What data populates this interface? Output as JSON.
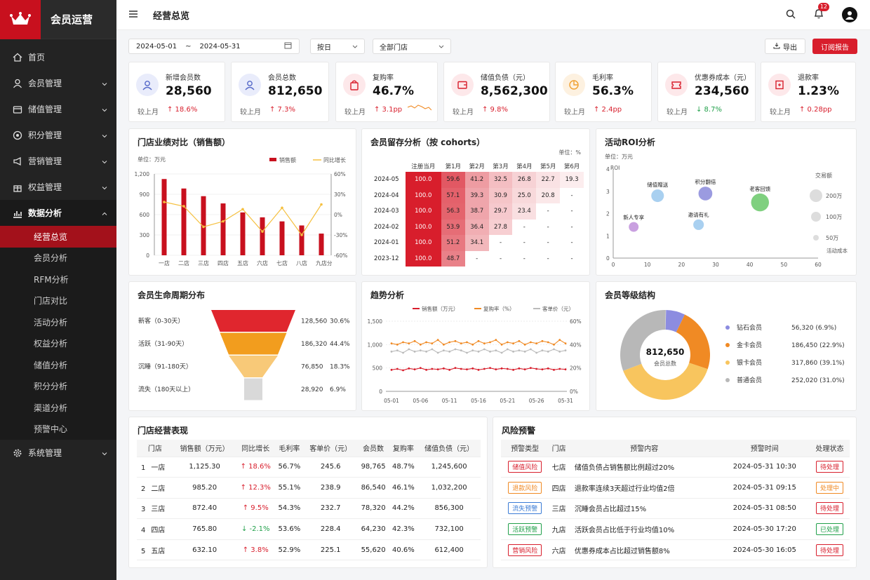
{
  "brand": {
    "name": "会员运营"
  },
  "nav": [
    {
      "label": "首页",
      "icon": "home-icon",
      "has_chevron": false
    },
    {
      "label": "会员管理",
      "icon": "user-icon",
      "has_chevron": true
    },
    {
      "label": "储值管理",
      "icon": "wallet-icon",
      "has_chevron": true
    },
    {
      "label": "积分管理",
      "icon": "points-icon",
      "has_chevron": true
    },
    {
      "label": "营销管理",
      "icon": "megaphone-icon",
      "has_chevron": true
    },
    {
      "label": "权益管理",
      "icon": "gift-icon",
      "has_chevron": true
    },
    {
      "label": "数据分析",
      "icon": "chart-icon",
      "has_chevron": true,
      "open": true
    },
    {
      "label": "系统管理",
      "icon": "gear-icon",
      "has_chevron": true
    }
  ],
  "subnav": [
    "经营总览",
    "会员分析",
    "RFM分析",
    "门店对比",
    "活动分析",
    "权益分析",
    "储值分析",
    "积分分析",
    "渠道分析",
    "预警中心"
  ],
  "topbar": {
    "title": "经营总览",
    "notif_count": "12"
  },
  "filters": {
    "date_start": "2024-05-01",
    "date_sep": "~",
    "date_end": "2024-05-31",
    "period": "按日",
    "store": "全部门店",
    "export": "导出",
    "subscribe": "订阅报告"
  },
  "kpis": [
    {
      "label": "新增会员数",
      "value": "28,560",
      "cmp": "较上月",
      "change": "↑ 18.6%",
      "dir": "up",
      "icon": "user-icon",
      "bg": "#e9ecfb",
      "fg": "#5568c8"
    },
    {
      "label": "会员总数",
      "value": "812,650",
      "cmp": "较上月",
      "change": "↑ 7.3%",
      "dir": "up",
      "icon": "users-icon",
      "bg": "#e9ecfb",
      "fg": "#5568c8"
    },
    {
      "label": "复购率",
      "value": "46.7%",
      "cmp": "较上月",
      "change": "↑ 3.1pp",
      "dir": "up",
      "icon": "bag-icon",
      "bg": "#fde8ea",
      "fg": "#d81e2c"
    },
    {
      "label": "储值负债（元）",
      "value": "8,562,300",
      "cmp": "较上月",
      "change": "↑ 9.8%",
      "dir": "up",
      "icon": "wallet-icon",
      "bg": "#fde8ea",
      "fg": "#d81e2c"
    },
    {
      "label": "毛利率",
      "value": "56.3%",
      "cmp": "较上月",
      "change": "↑ 2.4pp",
      "dir": "up",
      "icon": "pie-icon",
      "bg": "#fdf1e0",
      "fg": "#f0a030"
    },
    {
      "label": "优惠券成本（元）",
      "value": "234,560",
      "cmp": "较上月",
      "change": "↓ 8.7%",
      "dir": "down",
      "icon": "coupon-icon",
      "bg": "#fde8ea",
      "fg": "#d81e2c"
    },
    {
      "label": "退款率",
      "value": "1.23%",
      "cmp": "较上月",
      "change": "↑ 0.28pp",
      "dir": "up",
      "icon": "refund-icon",
      "bg": "#fde8ea",
      "fg": "#d81e2c"
    }
  ],
  "chart_data": [
    {
      "type": "bar",
      "title": "门店业绩对比（销售额）",
      "unit": "单位：万元",
      "categories": [
        "一店",
        "二店",
        "三店",
        "四店",
        "五店",
        "六店",
        "七店",
        "八店",
        "九店"
      ],
      "series": [
        {
          "name": "销售额",
          "values": [
            1125,
            985,
            872,
            765,
            632,
            560,
            500,
            440,
            320
          ]
        },
        {
          "name": "同比增长",
          "values": [
            18.6,
            12.3,
            -18,
            -10,
            8,
            -25,
            10,
            -30,
            15
          ]
        }
      ],
      "ylim": [
        0,
        1200
      ],
      "y2lim": [
        -60,
        60
      ],
      "yticks": [
        "1,200",
        "900",
        "600",
        "300",
        "0"
      ],
      "y2ticks": [
        "60%",
        "30%",
        "0%",
        "-30%",
        "-60%"
      ],
      "x_overflow": "分"
    },
    {
      "type": "table",
      "title": "会员留存分析（按 cohorts）",
      "unit": "单位：%",
      "columns": [
        "注册当月",
        "第1月",
        "第2月",
        "第3月",
        "第4月",
        "第5月",
        "第6月"
      ],
      "rows": [
        {
          "cohort": "2024-05",
          "values": [
            "100.0",
            "59.6",
            "41.2",
            "32.5",
            "26.8",
            "22.7",
            "19.3"
          ]
        },
        {
          "cohort": "2024-04",
          "values": [
            "100.0",
            "57.1",
            "39.3",
            "30.9",
            "25.0",
            "20.8",
            "-"
          ]
        },
        {
          "cohort": "2024-03",
          "values": [
            "100.0",
            "56.3",
            "38.7",
            "29.7",
            "23.4",
            "-",
            "-"
          ]
        },
        {
          "cohort": "2024-02",
          "values": [
            "100.0",
            "53.9",
            "36.4",
            "27.8",
            "-",
            "-",
            "-"
          ]
        },
        {
          "cohort": "2024-01",
          "values": [
            "100.0",
            "51.2",
            "34.1",
            "-",
            "-",
            "-",
            "-"
          ]
        },
        {
          "cohort": "2023-12",
          "values": [
            "100.0",
            "48.7",
            "-",
            "-",
            "-",
            "-",
            "-"
          ]
        }
      ]
    },
    {
      "type": "scatter",
      "title": "活动ROI分析",
      "unit": "单位：万元",
      "xlabel": "活动成本",
      "ylabel": "ROI",
      "xlim": [
        0,
        60
      ],
      "ylim": [
        0,
        4
      ],
      "size_legend_title": "交易额",
      "size_legend": [
        "200万",
        "100万",
        "50万"
      ],
      "points": [
        {
          "name": "储值赠送",
          "x": 13,
          "y": 2.8,
          "size": 100,
          "color": "#a9d0f0"
        },
        {
          "name": "积分翻倍",
          "x": 27,
          "y": 2.9,
          "size": 120,
          "color": "#9b9be0"
        },
        {
          "name": "老客回馈",
          "x": 43,
          "y": 2.5,
          "size": 200,
          "color": "#7fd07f"
        },
        {
          "name": "新人专享",
          "x": 6,
          "y": 1.4,
          "size": 60,
          "color": "#c9a0e0"
        },
        {
          "name": "邀请有礼",
          "x": 25,
          "y": 1.5,
          "size": 70,
          "color": "#a9d0f0"
        }
      ]
    },
    {
      "type": "funnel",
      "title": "会员生命周期分布",
      "stages": [
        {
          "label": "新客（0-30天）",
          "count": "128,560",
          "pct": "30.6%",
          "color": "#e0262e"
        },
        {
          "label": "活跃（31-90天）",
          "count": "186,320",
          "pct": "44.4%",
          "color": "#f29d1e"
        },
        {
          "label": "沉睡（91-180天）",
          "count": "76,850",
          "pct": "18.3%",
          "color": "#f8c978"
        },
        {
          "label": "流失（180天以上）",
          "count": "28,920",
          "pct": "6.9%",
          "color": "#d9d9d9"
        }
      ]
    },
    {
      "type": "line",
      "title": "趋势分析",
      "x_ticks": [
        "05-01",
        "05-06",
        "05-11",
        "05-16",
        "05-21",
        "05-26",
        "05-31"
      ],
      "yticks": [
        "1,500",
        "1,000",
        "500",
        "0"
      ],
      "y2ticks": [
        "60%",
        "40%",
        "20%",
        "0%"
      ],
      "series": [
        {
          "name": "销售额（万元）",
          "color": "#d81e2c",
          "axis": "left",
          "values": [
            460,
            480,
            450,
            490,
            470,
            500,
            460,
            480,
            470,
            490,
            460,
            500,
            480,
            470,
            490,
            460,
            480,
            500,
            470,
            490,
            480,
            460,
            490,
            470,
            500,
            480,
            470,
            490,
            460,
            480,
            470
          ]
        },
        {
          "name": "复购率（%）",
          "color": "#f08a24",
          "axis": "right",
          "values": [
            41,
            40,
            42,
            41,
            43,
            40,
            42,
            41,
            44,
            40,
            42,
            43,
            41,
            42,
            40,
            43,
            41,
            42,
            44,
            40,
            42,
            41,
            43,
            40,
            42,
            41,
            43,
            42,
            40,
            44,
            41
          ]
        },
        {
          "name": "客单价（元）",
          "color": "#bbbbbb",
          "axis": "right",
          "values": [
            34,
            35,
            33,
            36,
            34,
            35,
            34,
            36,
            33,
            35,
            34,
            36,
            35,
            33,
            35,
            34,
            36,
            34,
            35,
            33,
            36,
            34,
            35,
            34,
            36,
            33,
            35,
            34,
            36,
            34,
            35
          ]
        }
      ],
      "ylim": [
        0,
        1500
      ],
      "y2lim": [
        0,
        60
      ]
    },
    {
      "type": "pie",
      "title": "会员等级结构",
      "center_value": "812,650",
      "center_label": "会员总数",
      "slices": [
        {
          "name": "钻石会员",
          "value": "56,320 (6.9%)",
          "pct": 6.9,
          "color": "#8c8ce0"
        },
        {
          "name": "金卡会员",
          "value": "186,450 (22.9%)",
          "pct": 22.9,
          "color": "#f08a24"
        },
        {
          "name": "银卡会员",
          "value": "317,860 (39.1%)",
          "pct": 39.1,
          "color": "#f8c55e"
        },
        {
          "name": "普通会员",
          "value": "252,020 (31.0%)",
          "pct": 31.0,
          "color": "#b8b8b8"
        }
      ]
    }
  ],
  "store_table": {
    "title": "门店经营表现",
    "headers": [
      "门店",
      "销售额（万元）",
      "同比增长",
      "毛利率",
      "客单价（元）",
      "会员数",
      "复购率",
      "储值负债（元）"
    ],
    "rows": [
      {
        "rank": "1",
        "store": "一店",
        "sales": "1,125.30",
        "yoy": "↑ 18.6%",
        "dir": "up",
        "margin": "56.7%",
        "aov": "245.6",
        "members": "98,765",
        "repurchase": "48.7%",
        "debt": "1,245,600"
      },
      {
        "rank": "2",
        "store": "二店",
        "sales": "985.20",
        "yoy": "↑ 12.3%",
        "dir": "up",
        "margin": "55.1%",
        "aov": "238.9",
        "members": "86,540",
        "repurchase": "46.1%",
        "debt": "1,032,200"
      },
      {
        "rank": "3",
        "store": "三店",
        "sales": "872.40",
        "yoy": "↑ 9.5%",
        "dir": "up",
        "margin": "54.3%",
        "aov": "232.7",
        "members": "78,320",
        "repurchase": "44.2%",
        "debt": "856,300"
      },
      {
        "rank": "4",
        "store": "四店",
        "sales": "765.80",
        "yoy": "↓ -2.1%",
        "dir": "down",
        "margin": "53.6%",
        "aov": "228.4",
        "members": "64,230",
        "repurchase": "42.3%",
        "debt": "732,100"
      },
      {
        "rank": "5",
        "store": "五店",
        "sales": "632.10",
        "yoy": "↑ 3.8%",
        "dir": "up",
        "margin": "52.9%",
        "aov": "225.1",
        "members": "55,620",
        "repurchase": "40.6%",
        "debt": "612,400"
      }
    ]
  },
  "risk_table": {
    "title": "风险预警",
    "headers": [
      "预警类型",
      "门店",
      "预警内容",
      "预警时间",
      "处理状态"
    ],
    "rows": [
      {
        "type": "储值风险",
        "tcolor": "#d81e2c",
        "store": "七店",
        "content": "储值负债占销售额比例超过20%",
        "time": "2024-05-31 10:30",
        "status": "待处理",
        "scolor": "#d81e2c"
      },
      {
        "type": "退款风险",
        "tcolor": "#f08a24",
        "store": "四店",
        "content": "退款率连续3天超过行业均值2倍",
        "time": "2024-05-31 09:15",
        "status": "处理中",
        "scolor": "#f08a24"
      },
      {
        "type": "流失预警",
        "tcolor": "#3a7bd5",
        "store": "三店",
        "content": "沉睡会员占比超过15%",
        "time": "2024-05-31 08:50",
        "status": "待处理",
        "scolor": "#d81e2c"
      },
      {
        "type": "活跃预警",
        "tcolor": "#21a04a",
        "store": "九店",
        "content": "活跃会员占比低于行业均值10%",
        "time": "2024-05-30 17:20",
        "status": "已处理",
        "scolor": "#21a04a"
      },
      {
        "type": "营销风险",
        "tcolor": "#d81e2c",
        "store": "六店",
        "content": "优惠券成本占比超过销售额8%",
        "time": "2024-05-30 16:05",
        "status": "待处理",
        "scolor": "#d81e2c"
      }
    ]
  }
}
